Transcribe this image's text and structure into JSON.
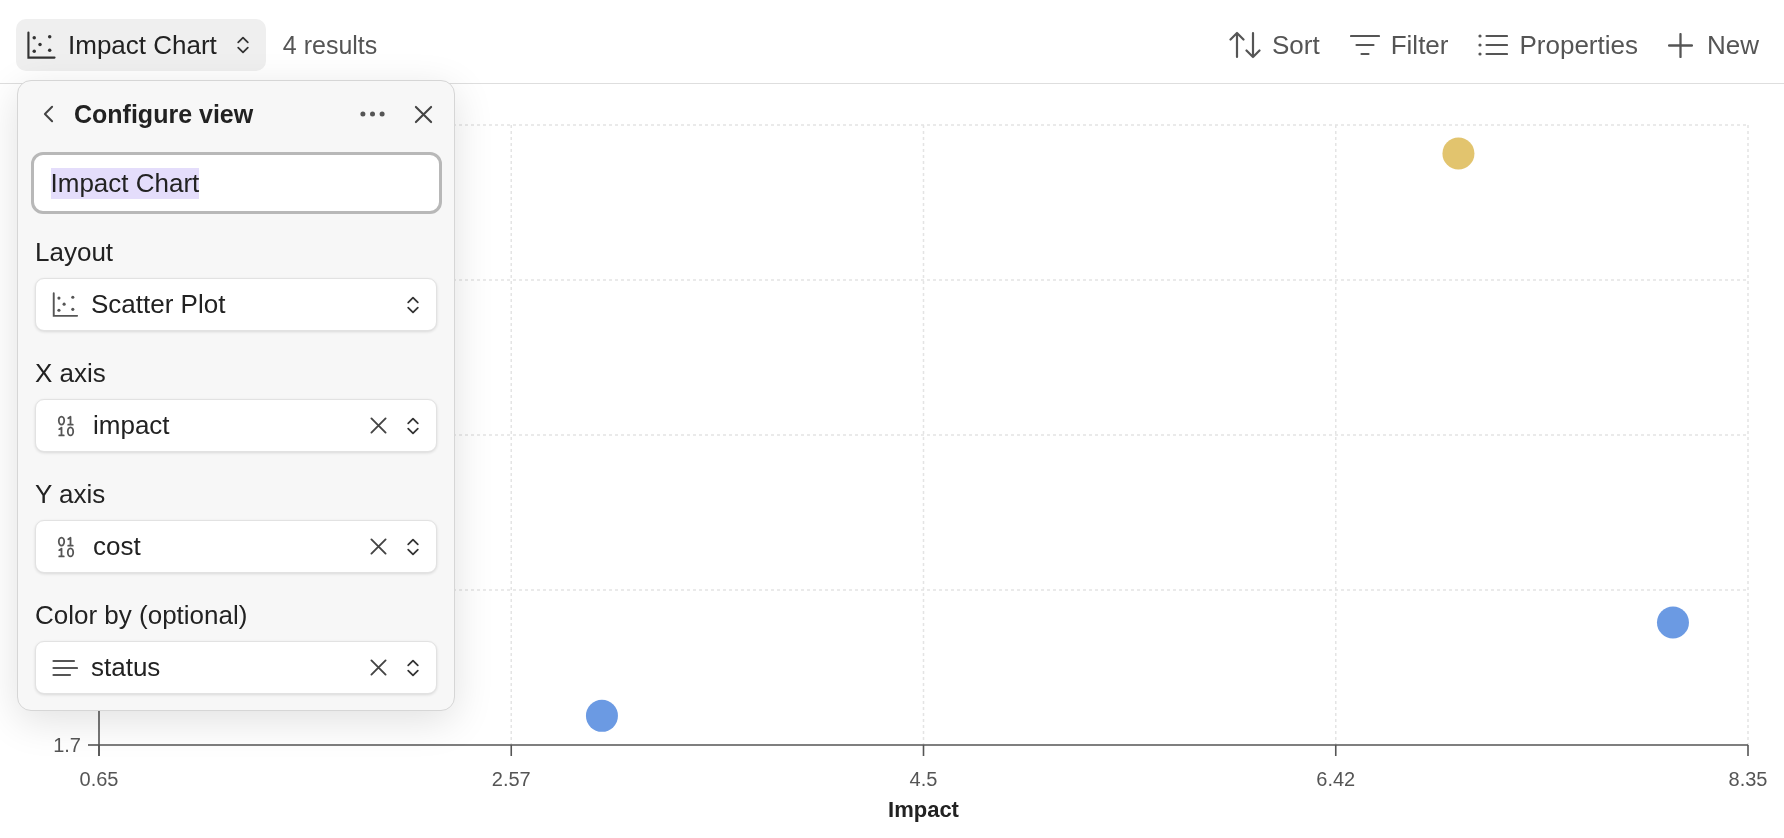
{
  "toolbar": {
    "view_button": {
      "label": "Impact Chart"
    },
    "result_count": "4 results",
    "actions": [
      {
        "kind": "sort",
        "label": "Sort"
      },
      {
        "kind": "filter",
        "label": "Filter"
      },
      {
        "kind": "properties",
        "label": "Properties"
      },
      {
        "kind": "new",
        "label": "New"
      }
    ]
  },
  "config_panel": {
    "title": "Configure view",
    "name_field": {
      "value": "Impact Chart",
      "text_selected": true
    },
    "fields": [
      {
        "kind": "layout",
        "label": "Layout",
        "value": "Scatter Plot",
        "clearable": false
      },
      {
        "kind": "number",
        "label": "X axis",
        "value": "impact",
        "clearable": true
      },
      {
        "kind": "number",
        "label": "Y axis",
        "value": "cost",
        "clearable": true
      },
      {
        "kind": "text",
        "label": "Color by (optional)",
        "value": "status",
        "clearable": true
      }
    ]
  },
  "chart": {
    "y_ticks": [
      "1.7"
    ],
    "x_ticks": [
      "0.65",
      "2.57",
      "4.5",
      "6.42",
      "8.35"
    ],
    "xlabel": "Impact",
    "points": [
      {
        "color": "#e2c46e"
      },
      {
        "color": "#6b9ae3"
      },
      {
        "color": "#6b9ae3"
      }
    ]
  }
}
